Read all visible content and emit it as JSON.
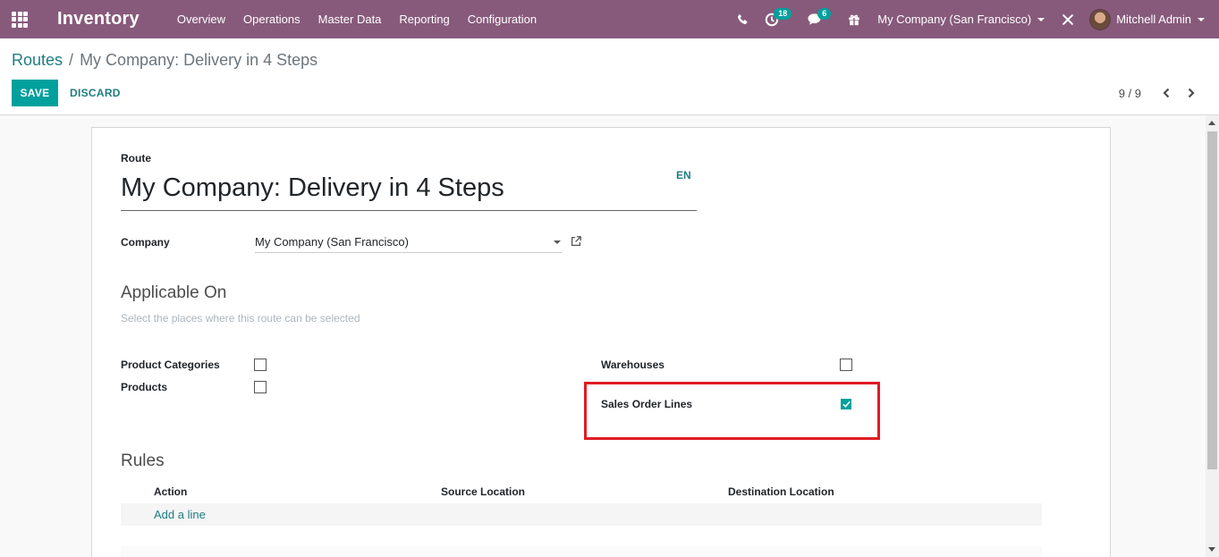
{
  "navbar": {
    "app_name": "Inventory",
    "menu": [
      "Overview",
      "Operations",
      "Master Data",
      "Reporting",
      "Configuration"
    ],
    "activity_count": "18",
    "messages_count": "6",
    "company": "My Company (San Francisco)",
    "user": "Mitchell Admin",
    "icons": [
      "apps-grid-icon",
      "phone-icon",
      "clock-icon",
      "chat-icon",
      "gift-icon",
      "close-tools-icon"
    ]
  },
  "breadcrumb": {
    "parent": "Routes",
    "separator": "/",
    "current": "My Company: Delivery in 4 Steps"
  },
  "actions": {
    "save": "SAVE",
    "discard": "DISCARD"
  },
  "pager": {
    "value": "9 / 9"
  },
  "form": {
    "route_label": "Route",
    "route_name": "My Company: Delivery in 4 Steps",
    "lang": "EN",
    "company_label": "Company",
    "company_value": "My Company (San Francisco)",
    "applicable_title": "Applicable On",
    "applicable_hint": "Select the places where this route can be selected",
    "applicable": {
      "product_categories": {
        "label": "Product Categories",
        "checked": false
      },
      "products": {
        "label": "Products",
        "checked": false
      },
      "warehouses": {
        "label": "Warehouses",
        "checked": false
      },
      "sales_order_lines": {
        "label": "Sales Order Lines",
        "checked": true
      }
    },
    "rules_title": "Rules",
    "rules_columns": [
      "Action",
      "Source Location",
      "Destination Location"
    ],
    "add_line": "Add a line"
  },
  "colors": {
    "navbar": "#875a7b",
    "primary": "#00a09d",
    "link": "#1f7d81",
    "highlight": "#e01b24"
  }
}
